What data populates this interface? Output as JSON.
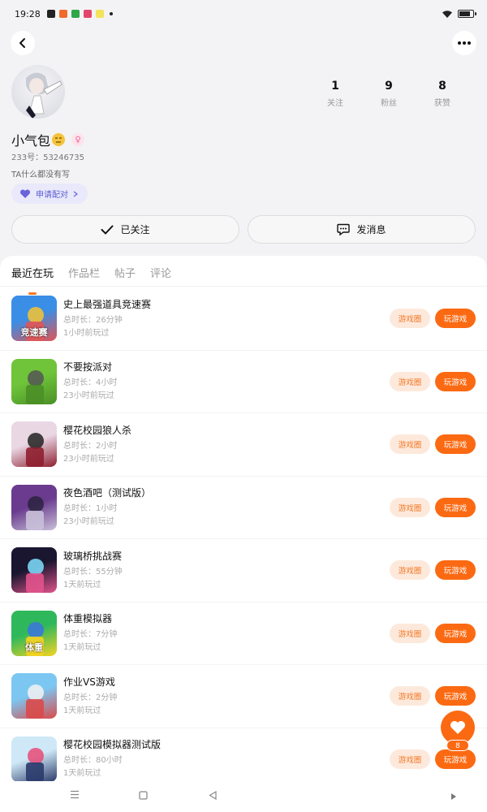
{
  "status": {
    "time": "19:28"
  },
  "profile": {
    "nickname": "小气包",
    "uid": "233号：53246735",
    "bio": "TA什么都没有写",
    "pair_label": "申请配对",
    "stats": [
      {
        "num": "1",
        "label": "关注"
      },
      {
        "num": "9",
        "label": "粉丝"
      },
      {
        "num": "8",
        "label": "获赞"
      }
    ],
    "followed_label": "已关注",
    "message_label": "发消息"
  },
  "tabs": [
    "最近在玩",
    "作品栏",
    "帖子",
    "评论"
  ],
  "games": [
    {
      "name": "史上最强道具竞速赛",
      "duration": "总时长：26分钟",
      "last": "1小时前玩过",
      "thumb_text": "竞速赛",
      "colors": [
        "#3a8ee6",
        "#e05555",
        "#f7c431"
      ]
    },
    {
      "name": "不要按派对",
      "duration": "总时长：4小时",
      "last": "23小时前玩过",
      "thumb_text": "",
      "colors": [
        "#6fc43a",
        "#4a8f27",
        "#555"
      ]
    },
    {
      "name": "樱花校园狼人杀",
      "duration": "总时长：2小时",
      "last": "23小时前玩过",
      "thumb_text": "",
      "colors": [
        "#e9d7e4",
        "#8e1f2f",
        "#222"
      ]
    },
    {
      "name": "夜色酒吧（测试版）",
      "duration": "总时长：1小时",
      "last": "23小时前玩过",
      "thumb_text": "",
      "colors": [
        "#6a3b8e",
        "#c9c0d8",
        "#2a2340"
      ]
    },
    {
      "name": "玻璃桥挑战赛",
      "duration": "总时长：55分钟",
      "last": "1天前玩过",
      "thumb_text": "",
      "colors": [
        "#1a1630",
        "#e2538c",
        "#7fe0ff"
      ]
    },
    {
      "name": "体重模拟器",
      "duration": "总时长：7分钟",
      "last": "1天前玩过",
      "thumb_text": "体重",
      "colors": [
        "#2fb85b",
        "#f5d421",
        "#3b74e0"
      ]
    },
    {
      "name": "作业VS游戏",
      "duration": "总时长：2分钟",
      "last": "1天前玩过",
      "thumb_text": "",
      "colors": [
        "#7cc7f2",
        "#d94a4a",
        "#f2f2f2"
      ]
    },
    {
      "name": "樱花校园模拟器测试版",
      "duration": "总时长：80小时",
      "last": "1天前玩过",
      "thumb_text": "",
      "colors": [
        "#cfe8f7",
        "#2a3a6a",
        "#e84a77"
      ]
    }
  ],
  "game_circle_label": "游戏圈",
  "play_label": "玩游戏",
  "fav_count": "8",
  "colors": {
    "accent": "#fb6a12",
    "accent_soft": "#fde9db",
    "pair": "#5b5bd3"
  }
}
